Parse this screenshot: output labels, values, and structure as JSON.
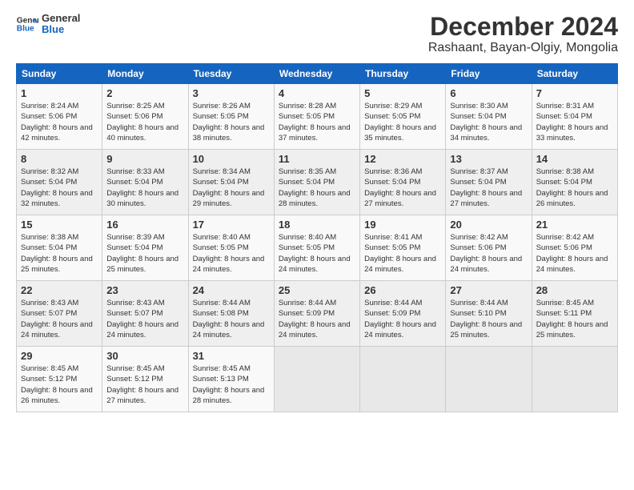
{
  "header": {
    "logo_line1": "General",
    "logo_line2": "Blue",
    "month": "December 2024",
    "location": "Rashaant, Bayan-Olgiy, Mongolia"
  },
  "weekdays": [
    "Sunday",
    "Monday",
    "Tuesday",
    "Wednesday",
    "Thursday",
    "Friday",
    "Saturday"
  ],
  "weeks": [
    [
      {
        "day": "1",
        "sunrise": "8:24 AM",
        "sunset": "5:06 PM",
        "daylight": "8 hours and 42 minutes."
      },
      {
        "day": "2",
        "sunrise": "8:25 AM",
        "sunset": "5:06 PM",
        "daylight": "8 hours and 40 minutes."
      },
      {
        "day": "3",
        "sunrise": "8:26 AM",
        "sunset": "5:05 PM",
        "daylight": "8 hours and 38 minutes."
      },
      {
        "day": "4",
        "sunrise": "8:28 AM",
        "sunset": "5:05 PM",
        "daylight": "8 hours and 37 minutes."
      },
      {
        "day": "5",
        "sunrise": "8:29 AM",
        "sunset": "5:05 PM",
        "daylight": "8 hours and 35 minutes."
      },
      {
        "day": "6",
        "sunrise": "8:30 AM",
        "sunset": "5:04 PM",
        "daylight": "8 hours and 34 minutes."
      },
      {
        "day": "7",
        "sunrise": "8:31 AM",
        "sunset": "5:04 PM",
        "daylight": "8 hours and 33 minutes."
      }
    ],
    [
      {
        "day": "8",
        "sunrise": "8:32 AM",
        "sunset": "5:04 PM",
        "daylight": "8 hours and 32 minutes."
      },
      {
        "day": "9",
        "sunrise": "8:33 AM",
        "sunset": "5:04 PM",
        "daylight": "8 hours and 30 minutes."
      },
      {
        "day": "10",
        "sunrise": "8:34 AM",
        "sunset": "5:04 PM",
        "daylight": "8 hours and 29 minutes."
      },
      {
        "day": "11",
        "sunrise": "8:35 AM",
        "sunset": "5:04 PM",
        "daylight": "8 hours and 28 minutes."
      },
      {
        "day": "12",
        "sunrise": "8:36 AM",
        "sunset": "5:04 PM",
        "daylight": "8 hours and 27 minutes."
      },
      {
        "day": "13",
        "sunrise": "8:37 AM",
        "sunset": "5:04 PM",
        "daylight": "8 hours and 27 minutes."
      },
      {
        "day": "14",
        "sunrise": "8:38 AM",
        "sunset": "5:04 PM",
        "daylight": "8 hours and 26 minutes."
      }
    ],
    [
      {
        "day": "15",
        "sunrise": "8:38 AM",
        "sunset": "5:04 PM",
        "daylight": "8 hours and 25 minutes."
      },
      {
        "day": "16",
        "sunrise": "8:39 AM",
        "sunset": "5:04 PM",
        "daylight": "8 hours and 25 minutes."
      },
      {
        "day": "17",
        "sunrise": "8:40 AM",
        "sunset": "5:05 PM",
        "daylight": "8 hours and 24 minutes."
      },
      {
        "day": "18",
        "sunrise": "8:40 AM",
        "sunset": "5:05 PM",
        "daylight": "8 hours and 24 minutes."
      },
      {
        "day": "19",
        "sunrise": "8:41 AM",
        "sunset": "5:05 PM",
        "daylight": "8 hours and 24 minutes."
      },
      {
        "day": "20",
        "sunrise": "8:42 AM",
        "sunset": "5:06 PM",
        "daylight": "8 hours and 24 minutes."
      },
      {
        "day": "21",
        "sunrise": "8:42 AM",
        "sunset": "5:06 PM",
        "daylight": "8 hours and 24 minutes."
      }
    ],
    [
      {
        "day": "22",
        "sunrise": "8:43 AM",
        "sunset": "5:07 PM",
        "daylight": "8 hours and 24 minutes."
      },
      {
        "day": "23",
        "sunrise": "8:43 AM",
        "sunset": "5:07 PM",
        "daylight": "8 hours and 24 minutes."
      },
      {
        "day": "24",
        "sunrise": "8:44 AM",
        "sunset": "5:08 PM",
        "daylight": "8 hours and 24 minutes."
      },
      {
        "day": "25",
        "sunrise": "8:44 AM",
        "sunset": "5:09 PM",
        "daylight": "8 hours and 24 minutes."
      },
      {
        "day": "26",
        "sunrise": "8:44 AM",
        "sunset": "5:09 PM",
        "daylight": "8 hours and 24 minutes."
      },
      {
        "day": "27",
        "sunrise": "8:44 AM",
        "sunset": "5:10 PM",
        "daylight": "8 hours and 25 minutes."
      },
      {
        "day": "28",
        "sunrise": "8:45 AM",
        "sunset": "5:11 PM",
        "daylight": "8 hours and 25 minutes."
      }
    ],
    [
      {
        "day": "29",
        "sunrise": "8:45 AM",
        "sunset": "5:12 PM",
        "daylight": "8 hours and 26 minutes."
      },
      {
        "day": "30",
        "sunrise": "8:45 AM",
        "sunset": "5:12 PM",
        "daylight": "8 hours and 27 minutes."
      },
      {
        "day": "31",
        "sunrise": "8:45 AM",
        "sunset": "5:13 PM",
        "daylight": "8 hours and 28 minutes."
      },
      null,
      null,
      null,
      null
    ]
  ]
}
